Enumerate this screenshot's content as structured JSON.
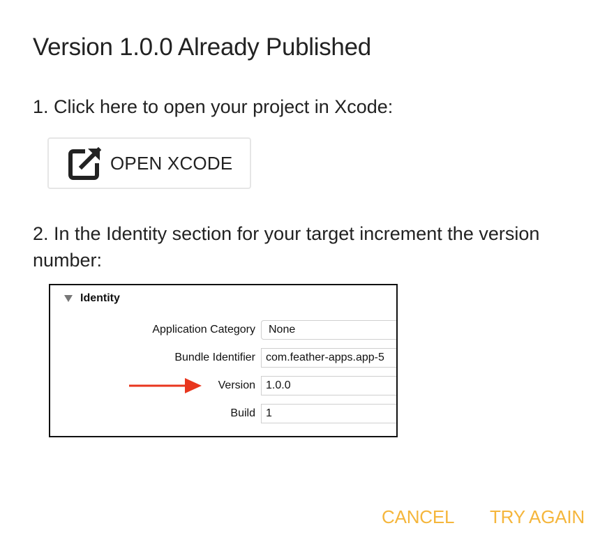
{
  "dialog": {
    "title": "Version 1.0.0 Already Published",
    "step1": "1. Click here to open your project in Xcode:",
    "open_xcode_label": "OPEN XCODE",
    "open_xcode_icon": "external-link-icon",
    "step2": "2. In the Identity section for your target increment the version number:",
    "identity": {
      "header": "Identity",
      "rows": [
        {
          "label": "Application Category",
          "value": "None"
        },
        {
          "label": "Bundle Identifier",
          "value": "com.feather-apps.app-5"
        },
        {
          "label": "Version",
          "value": "1.0.0"
        },
        {
          "label": "Build",
          "value": "1"
        }
      ],
      "arrow_color": "#e8361e"
    },
    "actions": {
      "cancel_label": "CANCEL",
      "try_again_label": "TRY AGAIN",
      "accent_color": "#f5b63c"
    }
  }
}
